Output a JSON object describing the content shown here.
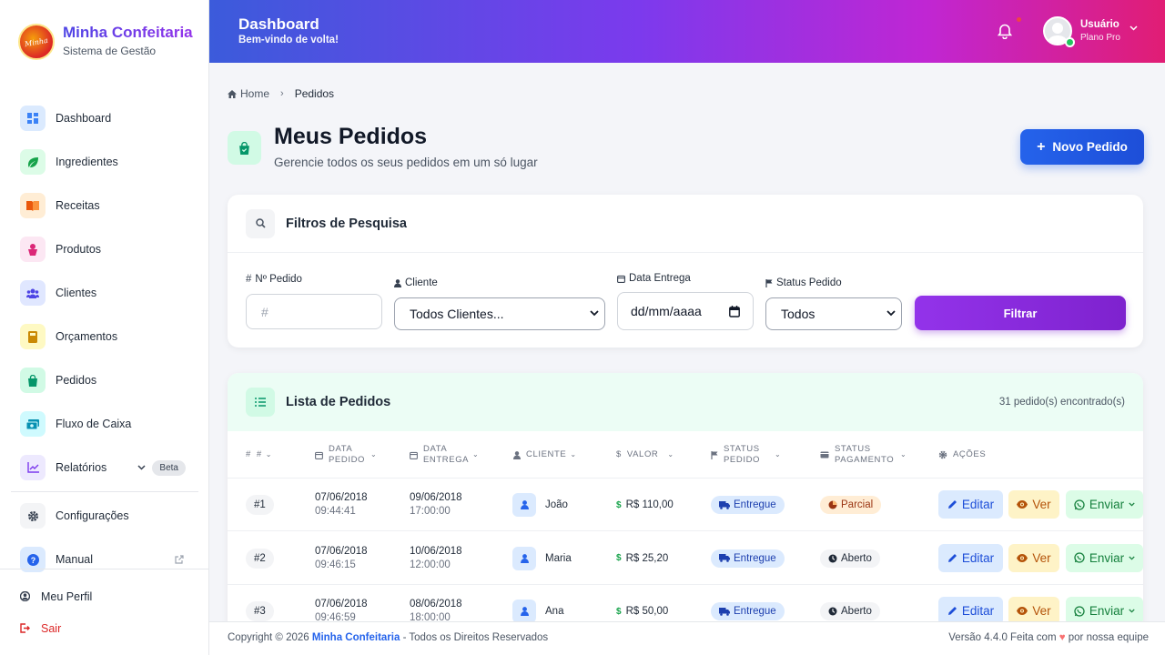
{
  "brand": {
    "name": "Minha Confeitaria",
    "subtitle": "Sistema de Gestão",
    "logo_text": "Minha Confeitaria"
  },
  "sidebar": {
    "items": [
      {
        "label": "Dashboard",
        "icon": "dashboard-icon",
        "color": "#3b82f6"
      },
      {
        "label": "Ingredientes",
        "icon": "leaf-icon",
        "color": "#16a34a"
      },
      {
        "label": "Receitas",
        "icon": "book-icon",
        "color": "#ea580c"
      },
      {
        "label": "Produtos",
        "icon": "cake-icon",
        "color": "#db2777"
      },
      {
        "label": "Clientes",
        "icon": "users-icon",
        "color": "#4f46e5"
      },
      {
        "label": "Orçamentos",
        "icon": "calculator-icon",
        "color": "#ca8a04"
      },
      {
        "label": "Pedidos",
        "icon": "shopping-bag-icon",
        "color": "#059669"
      },
      {
        "label": "Fluxo de Caixa",
        "icon": "money-icon",
        "color": "#0891b2"
      },
      {
        "label": "Relatórios",
        "icon": "chart-line-icon",
        "color": "#7c3aed",
        "badge": "Beta"
      },
      {
        "label": "Configurações",
        "icon": "gear-icon",
        "color": "#374151"
      },
      {
        "label": "Manual",
        "icon": "question-icon",
        "color": "#2563eb"
      }
    ],
    "bottom": [
      {
        "label": "Meu Perfil",
        "icon": "user-circle-icon"
      },
      {
        "label": "Sair",
        "icon": "logout-icon",
        "color": "#dc2626"
      }
    ]
  },
  "topbar": {
    "title": "Dashboard",
    "subtitle": "Bem-vindo de volta!",
    "user_name": "Usuário",
    "user_plan": "Plano Pro"
  },
  "breadcrumb": {
    "home": "Home",
    "current": "Pedidos"
  },
  "page": {
    "title": "Meus Pedidos",
    "subtitle": "Gerencie todos os seus pedidos em um só lugar",
    "new_button": "Novo Pedido"
  },
  "filters": {
    "title": "Filtros de Pesquisa",
    "order_label": "Nº Pedido",
    "order_placeholder": "#",
    "client_label": "Cliente",
    "client_value": "Todos Clientes...",
    "date_label": "Data Entrega",
    "date_value": "dd/mm/aaaa",
    "status_label": "Status Pedido",
    "status_value": "Todos",
    "button": "Filtrar"
  },
  "list": {
    "title": "Lista de Pedidos",
    "count": "31 pedido(s) encontrado(s)",
    "columns": [
      "#",
      "Data Pedido",
      "Data Entrega",
      "Cliente",
      "Valor",
      "Status Pedido",
      "Status Pagamento",
      "Ações"
    ],
    "actions": {
      "edit": "Editar",
      "view": "Ver",
      "send": "Enviar"
    },
    "rows": [
      {
        "id": "#1",
        "order_date": "07/06/2018",
        "order_time": "09:44:41",
        "delivery_date": "09/06/2018",
        "delivery_time": "17:00:00",
        "client": "João",
        "value": "R$ 110,00",
        "status": "Entregue",
        "payment": "Parcial",
        "payment_style": "orange"
      },
      {
        "id": "#2",
        "order_date": "07/06/2018",
        "order_time": "09:46:15",
        "delivery_date": "10/06/2018",
        "delivery_time": "12:00:00",
        "client": "Maria",
        "value": "R$ 25,20",
        "status": "Entregue",
        "payment": "Aberto",
        "payment_style": "gray"
      },
      {
        "id": "#3",
        "order_date": "07/06/2018",
        "order_time": "09:46:59",
        "delivery_date": "08/06/2018",
        "delivery_time": "18:00:00",
        "client": "Ana",
        "value": "R$ 50,00",
        "status": "Entregue",
        "payment": "Aberto",
        "payment_style": "gray"
      }
    ]
  },
  "footer": {
    "copyright": "Copyright © 2026",
    "brand": "Minha Confeitaria",
    "rights": "- Todos os Direitos Reservados",
    "version": "Versão 4.4.0 Feita com",
    "love": "por nossa equipe"
  }
}
